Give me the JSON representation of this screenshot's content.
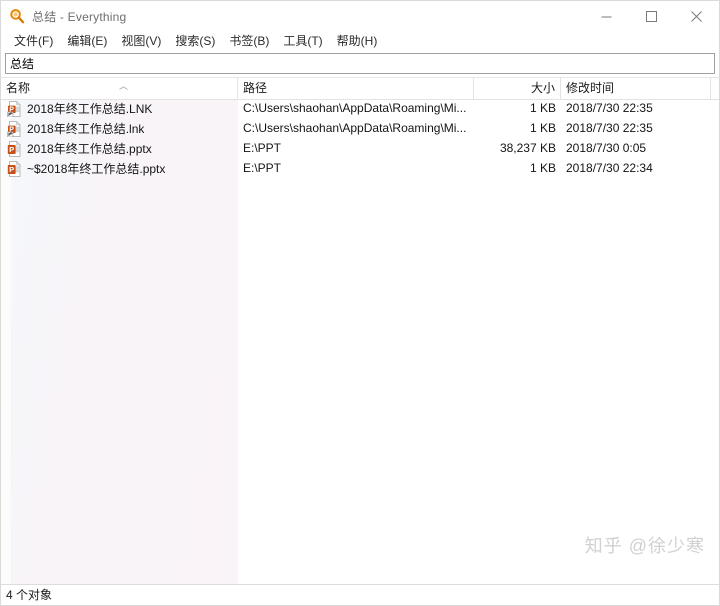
{
  "window": {
    "title": "总结 - Everything",
    "icon": "magnifier-icon",
    "accent_color": "#e8890c",
    "controls": {
      "minimize": "minimize-icon",
      "maximize": "maximize-icon",
      "close": "close-icon"
    }
  },
  "menubar": {
    "items": [
      {
        "label": "文件(F)"
      },
      {
        "label": "编辑(E)"
      },
      {
        "label": "视图(V)"
      },
      {
        "label": "搜索(S)"
      },
      {
        "label": "书签(B)"
      },
      {
        "label": "工具(T)"
      },
      {
        "label": "帮助(H)"
      }
    ]
  },
  "search": {
    "value": "总结",
    "placeholder": ""
  },
  "table": {
    "columns": [
      {
        "label": "名称",
        "align": "left",
        "sort": "ascending",
        "sort_glyph": "︿"
      },
      {
        "label": "路径",
        "align": "left",
        "sort": "none"
      },
      {
        "label": "大小",
        "align": "right",
        "sort": "none"
      },
      {
        "label": "修改时间",
        "align": "left",
        "sort": "none"
      }
    ],
    "rows": [
      {
        "icon": "powerpoint-shortcut-icon",
        "name": "2018年终工作总结.LNK",
        "path": "C:\\Users\\shaohan\\AppData\\Roaming\\Mi...",
        "size": "1 KB",
        "modified": "2018/7/30 22:35"
      },
      {
        "icon": "powerpoint-shortcut-icon",
        "name": "2018年终工作总结.lnk",
        "path": "C:\\Users\\shaohan\\AppData\\Roaming\\Mi...",
        "size": "1 KB",
        "modified": "2018/7/30 22:35"
      },
      {
        "icon": "powerpoint-icon",
        "name": "2018年终工作总结.pptx",
        "path": "E:\\PPT",
        "size": "38,237 KB",
        "modified": "2018/7/30 0:05"
      },
      {
        "icon": "powerpoint-icon",
        "name": "~$2018年终工作总结.pptx",
        "path": "E:\\PPT",
        "size": "1 KB",
        "modified": "2018/7/30 22:34"
      }
    ]
  },
  "statusbar": {
    "text": "4 个对象"
  },
  "watermark": {
    "text": "知乎 @徐少寒"
  }
}
